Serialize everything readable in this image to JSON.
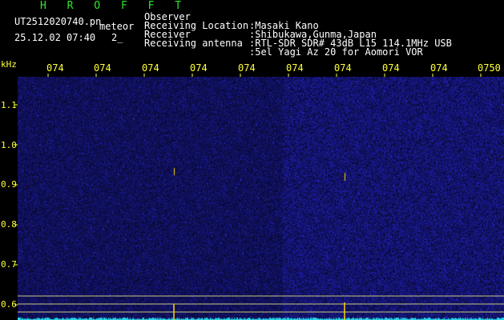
{
  "header": {
    "title": "H R O F F T",
    "filename": "UT2512020740.pn",
    "detection_tag": "meteor",
    "timestamp": "25.12.02 07:40",
    "count": "2_"
  },
  "info": [
    {
      "label": "Observer",
      "value": ":Masaki Kano"
    },
    {
      "label": "Receiving Location",
      "value": ":Shibukawa,Gunma,Japan"
    },
    {
      "label": "Receiver",
      "value": ":RTL-SDR SDR# 43dB L15 114.1MHz USB"
    },
    {
      "label": "Receiving antenna",
      "value": ":5el Yagi Az 20 for Aomori VOR"
    }
  ],
  "time_axis": [
    "074",
    "074",
    "074",
    "074",
    "074",
    "074",
    "074",
    "074",
    "074",
    "0750"
  ],
  "freq_axis": {
    "unit": "kHz",
    "ticks": [
      "1.1",
      "1.0",
      "0.9",
      "0.8",
      "0.7",
      "0.6"
    ]
  },
  "colors": {
    "background": "#000000",
    "title_green": "#2ee82e",
    "axis_yellow": "#ffff3a",
    "noise_blue": "#1a1a8c",
    "echo_yellow": "#ffd400",
    "baseline_cyan": "#27d6e6"
  }
}
